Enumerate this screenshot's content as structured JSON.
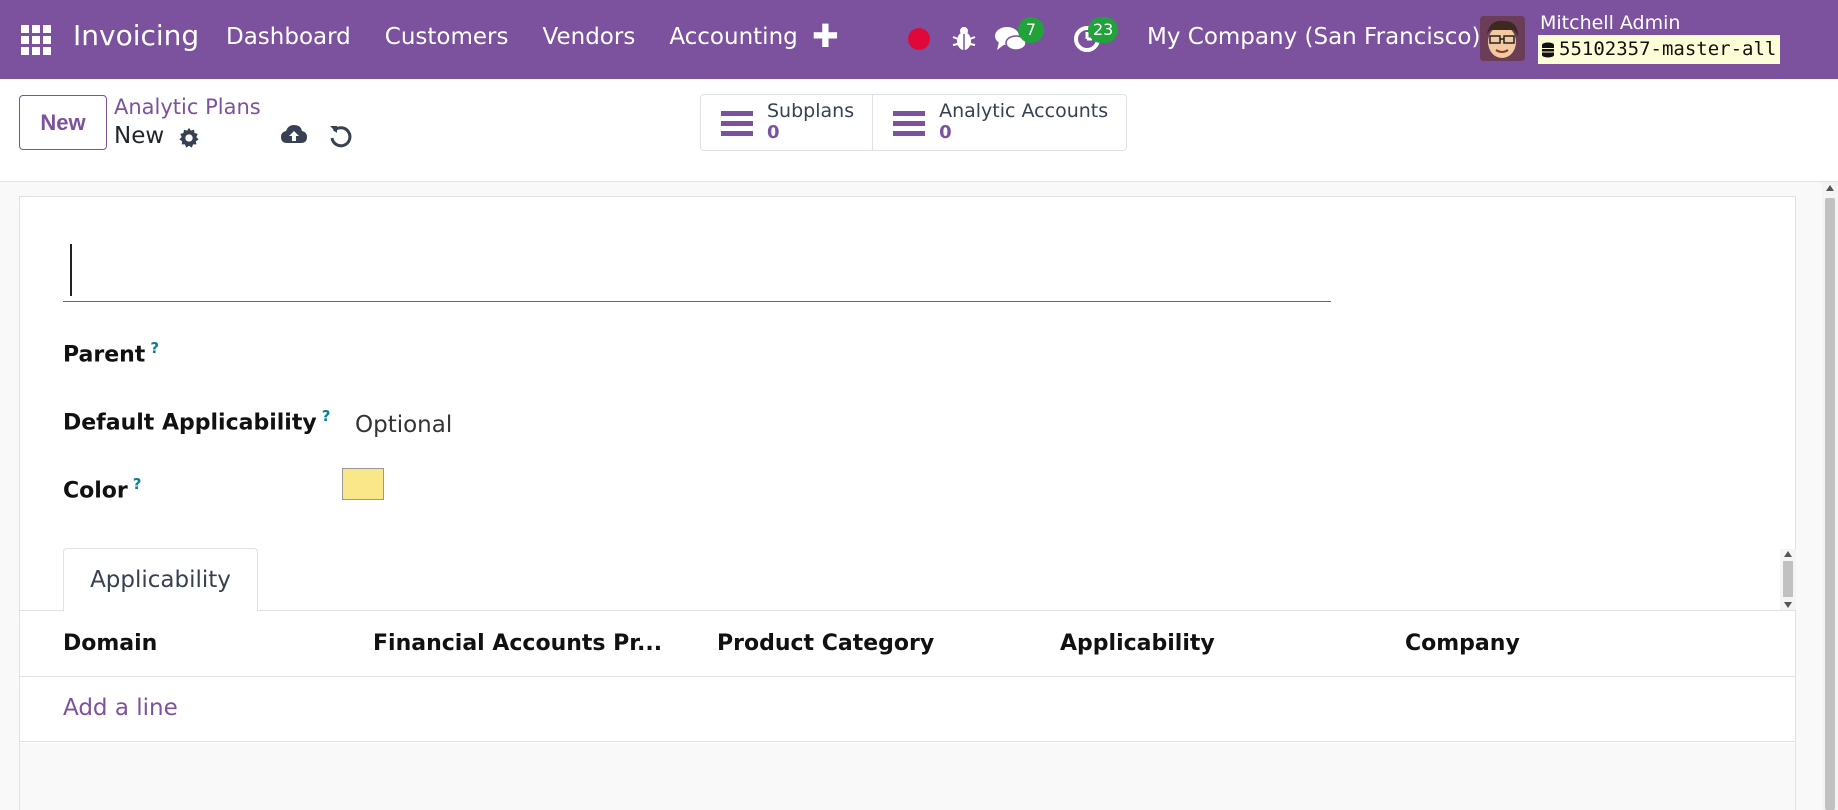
{
  "app": {
    "title": "Invoicing"
  },
  "nav": {
    "menu": [
      "Dashboard",
      "Customers",
      "Vendors",
      "Accounting"
    ],
    "chat_count": "7",
    "activity_count": "23",
    "company": "My Company (San Francisco)",
    "user_name": "Mitchell Admin",
    "database": "55102357-master-all",
    "icons": [
      "apps-icon",
      "plus-icon",
      "record-icon",
      "bug-icon",
      "chat-icon",
      "activity-icon",
      "database-icon"
    ]
  },
  "control": {
    "new_label": "New",
    "breadcrumb_parent": "Analytic Plans",
    "breadcrumb_current": "New",
    "smart_buttons": [
      {
        "label": "Subplans",
        "value": "0"
      },
      {
        "label": "Analytic Accounts",
        "value": "0"
      }
    ]
  },
  "form": {
    "name_value": "",
    "fields": {
      "parent": {
        "label": "Parent",
        "help": "?",
        "value": ""
      },
      "default_applicability": {
        "label": "Default Applicability",
        "help": "?",
        "value": "Optional"
      },
      "color": {
        "label": "Color",
        "help": "?",
        "value": "#f9e78a"
      }
    },
    "tabs": [
      "Applicability"
    ],
    "table": {
      "columns": [
        "Domain",
        "Financial Accounts Pr...",
        "Product Category",
        "Applicability",
        "Company"
      ],
      "add_line": "Add a line"
    }
  },
  "colors": {
    "brand": "#7c529e",
    "badge": "#21a23a",
    "record": "#e0083a",
    "help": "#0d7f93"
  }
}
